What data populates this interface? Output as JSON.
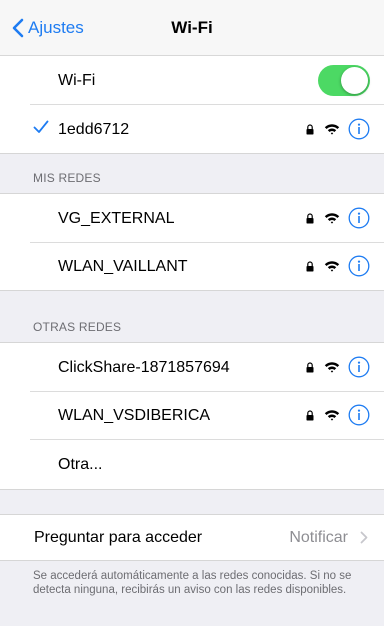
{
  "navbar": {
    "back_label": "Ajustes",
    "title": "Wi-Fi"
  },
  "wifi_toggle": {
    "label": "Wi-Fi",
    "enabled": true
  },
  "connected_network": {
    "name": "1edd6712",
    "secured": true,
    "connected": true
  },
  "my_networks": {
    "header": "MIS REDES",
    "items": [
      {
        "name": "VG_EXTERNAL",
        "secured": true
      },
      {
        "name": "WLAN_VAILLANT",
        "secured": true
      }
    ]
  },
  "other_networks": {
    "header": "OTRAS REDES",
    "items": [
      {
        "name": "ClickShare-1871857694",
        "secured": true
      },
      {
        "name": "WLAN_VSDIBERICA",
        "secured": true
      }
    ],
    "other_label": "Otra..."
  },
  "ask_to_join": {
    "label": "Preguntar para acceder",
    "value": "Notificar",
    "description": "Se accederá automáticamente a las redes conocidas. Si no se detecta ninguna, recibirás un aviso con las redes disponibles."
  },
  "colors": {
    "accent": "#1e7cf2",
    "toggle_on": "#4cd964",
    "background": "#efeff4"
  },
  "icons": {
    "back": "chevron-left-icon",
    "check": "checkmark-icon",
    "lock": "lock-icon",
    "wifi": "wifi-icon",
    "info": "info-icon",
    "chevron": "chevron-right-icon"
  }
}
